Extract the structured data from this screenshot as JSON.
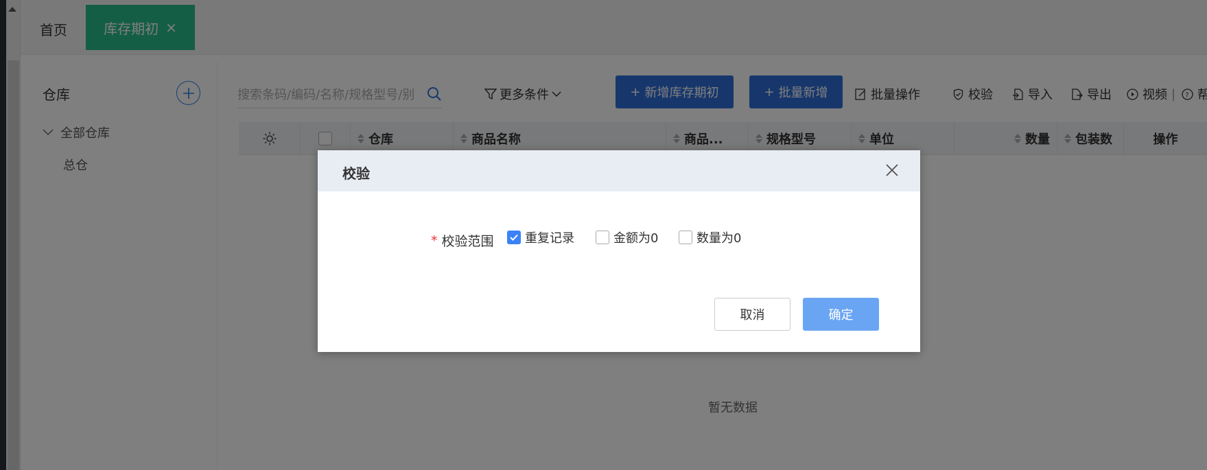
{
  "tabs": {
    "home": "首页",
    "active": "库存期初",
    "close": "×"
  },
  "sidebar": {
    "title": "仓库",
    "tree_root": "全部仓库",
    "tree_child": "总仓"
  },
  "toolbar": {
    "search_placeholder": "搜索条码/编码/名称/规格型号/别",
    "more_conditions": "更多条件",
    "add_label": "新增库存期初",
    "batch_add_label": "批量新增",
    "batch_ops": "批量操作",
    "verify": "校验",
    "import": "导入",
    "export": "导出",
    "video": "视频",
    "help": "帮"
  },
  "table": {
    "columns": [
      "仓库",
      "商品名称",
      "商品...",
      "规格型号",
      "单位",
      "数量",
      "包装数",
      "操作"
    ],
    "empty_text": "暂无数据"
  },
  "dialog": {
    "title": "校验",
    "field_label": "校验范围",
    "required_mark": "*",
    "options": [
      {
        "label": "重复记录",
        "checked": true
      },
      {
        "label": "金额为0",
        "checked": false
      },
      {
        "label": "数量为0",
        "checked": false
      }
    ],
    "cancel_label": "取消",
    "ok_label": "确定"
  },
  "colors": {
    "tab_active": "#2bbd8c",
    "primary": "#2f6fd8",
    "ok_button": "#6aa5f3",
    "checkbox_on": "#3b82f6"
  }
}
